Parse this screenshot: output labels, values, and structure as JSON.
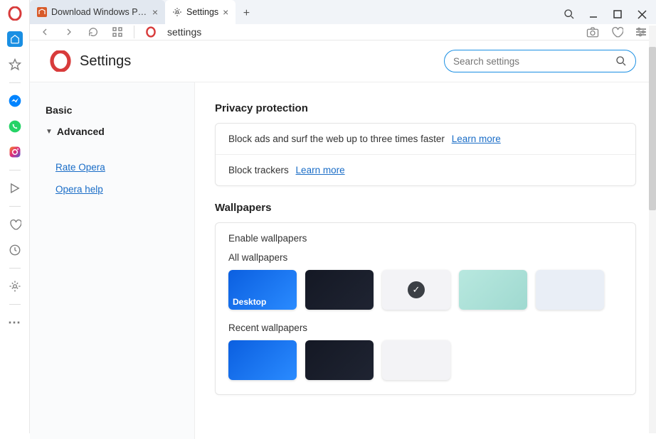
{
  "titlebar": {
    "tabs": [
      {
        "label": "Download Windows Progra",
        "active": false
      },
      {
        "label": "Settings",
        "active": true
      }
    ]
  },
  "addressbar": {
    "text": "settings"
  },
  "settings": {
    "title": "Settings",
    "search_placeholder": "Search settings",
    "nav": {
      "basic": "Basic",
      "advanced": "Advanced",
      "rate": "Rate Opera",
      "help": "Opera help"
    },
    "privacy": {
      "heading": "Privacy protection",
      "row1_text": "Block ads and surf the web up to three times faster",
      "row1_link": "Learn more",
      "row2_text": "Block trackers",
      "row2_link": "Learn more"
    },
    "wallpapers": {
      "heading": "Wallpapers",
      "enable": "Enable wallpapers",
      "all_label": "All wallpapers",
      "recent_label": "Recent wallpapers",
      "tiles": [
        {
          "label": "Desktop",
          "selected": false,
          "style": "wt1"
        },
        {
          "label": "",
          "selected": false,
          "style": "wt2"
        },
        {
          "label": "",
          "selected": true,
          "style": "wt3"
        },
        {
          "label": "",
          "selected": false,
          "style": "wt4"
        },
        {
          "label": "",
          "selected": false,
          "style": "wt5"
        }
      ],
      "recent_tiles": [
        {
          "style": "wt1"
        },
        {
          "style": "wt2"
        },
        {
          "style": "wt3"
        }
      ]
    }
  }
}
